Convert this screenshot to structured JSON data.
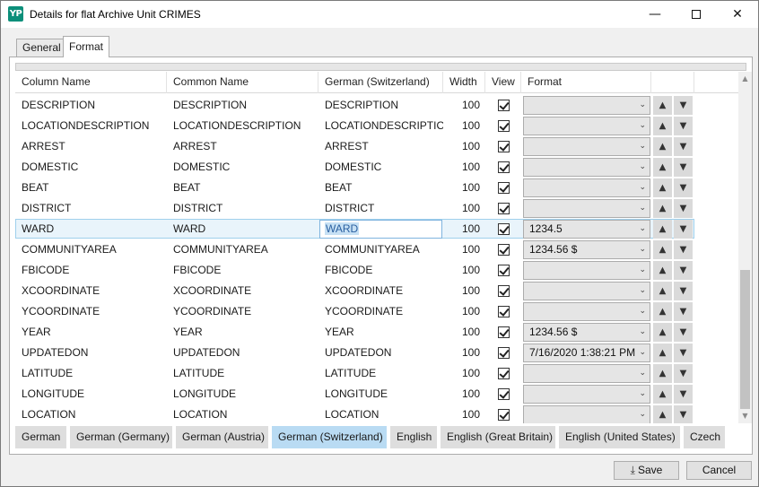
{
  "window": {
    "app_icon_text": "YP",
    "title": "Details for flat Archive Unit CRIMES",
    "minimize": "—",
    "close": "✕"
  },
  "tabs": [
    {
      "label": "General",
      "active": false
    },
    {
      "label": "Format",
      "active": true
    }
  ],
  "grid": {
    "headers": [
      "Column Name",
      "Common Name",
      "German (Switzerland)",
      "Width",
      "View",
      "Format"
    ],
    "rows": [
      {
        "column": "DESCRIPTION",
        "common": "DESCRIPTION",
        "german": "DESCRIPTION",
        "width": "100",
        "view": true,
        "format": ""
      },
      {
        "column": "LOCATIONDESCRIPTION",
        "common": "LOCATIONDESCRIPTION",
        "german": "LOCATIONDESCRIPTION",
        "width": "100",
        "view": true,
        "format": ""
      },
      {
        "column": "ARREST",
        "common": "ARREST",
        "german": "ARREST",
        "width": "100",
        "view": true,
        "format": ""
      },
      {
        "column": "DOMESTIC",
        "common": "DOMESTIC",
        "german": "DOMESTIC",
        "width": "100",
        "view": true,
        "format": ""
      },
      {
        "column": "BEAT",
        "common": "BEAT",
        "german": "BEAT",
        "width": "100",
        "view": true,
        "format": ""
      },
      {
        "column": "DISTRICT",
        "common": "DISTRICT",
        "german": "DISTRICT",
        "width": "100",
        "view": true,
        "format": ""
      },
      {
        "column": "WARD",
        "common": "WARD",
        "german": "WARD",
        "width": "100",
        "view": true,
        "format": "1234.5",
        "selected": true
      },
      {
        "column": "COMMUNITYAREA",
        "common": "COMMUNITYAREA",
        "german": "COMMUNITYAREA",
        "width": "100",
        "view": true,
        "format": "1234.56 $"
      },
      {
        "column": "FBICODE",
        "common": "FBICODE",
        "german": "FBICODE",
        "width": "100",
        "view": true,
        "format": ""
      },
      {
        "column": "XCOORDINATE",
        "common": "XCOORDINATE",
        "german": "XCOORDINATE",
        "width": "100",
        "view": true,
        "format": ""
      },
      {
        "column": "YCOORDINATE",
        "common": "YCOORDINATE",
        "german": "YCOORDINATE",
        "width": "100",
        "view": true,
        "format": ""
      },
      {
        "column": "YEAR",
        "common": "YEAR",
        "german": "YEAR",
        "width": "100",
        "view": true,
        "format": "1234.56 $"
      },
      {
        "column": "UPDATEDON",
        "common": "UPDATEDON",
        "german": "UPDATEDON",
        "width": "100",
        "view": true,
        "format": "7/16/2020 1:38:21 PM"
      },
      {
        "column": "LATITUDE",
        "common": "LATITUDE",
        "german": "LATITUDE",
        "width": "100",
        "view": true,
        "format": ""
      },
      {
        "column": "LONGITUDE",
        "common": "LONGITUDE",
        "german": "LONGITUDE",
        "width": "100",
        "view": true,
        "format": ""
      },
      {
        "column": "LOCATION",
        "common": "LOCATION",
        "german": "LOCATION",
        "width": "100",
        "view": true,
        "format": ""
      }
    ]
  },
  "languages": [
    {
      "label": "German",
      "active": false
    },
    {
      "label": "German (Germany)",
      "active": false
    },
    {
      "label": "German (Austria)",
      "active": false
    },
    {
      "label": "German (Switzerland)",
      "active": true
    },
    {
      "label": "English",
      "active": false
    },
    {
      "label": "English (Great Britain)",
      "active": false
    },
    {
      "label": "English (United States)",
      "active": false
    },
    {
      "label": "Czech",
      "active": false
    }
  ],
  "footer": {
    "save_label": "Save",
    "cancel_label": "Cancel"
  },
  "colors": {
    "selected_row_bg": "#e9f4fb",
    "active_language_bg": "#b9dbf3",
    "app_icon": "#0c8f7a"
  }
}
